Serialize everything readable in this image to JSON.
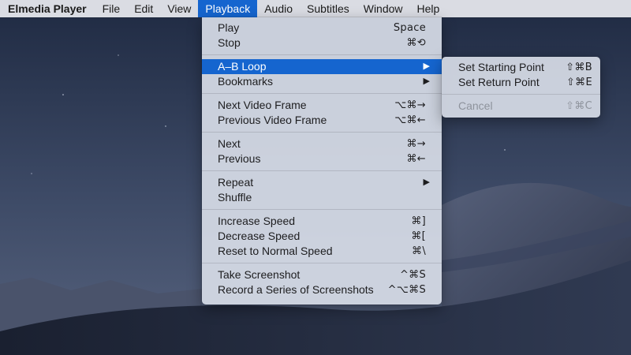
{
  "menubar": {
    "app": "Elmedia Player",
    "items": [
      {
        "label": "File"
      },
      {
        "label": "Edit"
      },
      {
        "label": "View"
      },
      {
        "label": "Playback"
      },
      {
        "label": "Audio"
      },
      {
        "label": "Subtitles"
      },
      {
        "label": "Window"
      },
      {
        "label": "Help"
      }
    ]
  },
  "playback_menu": {
    "play": {
      "label": "Play",
      "shortcut": "Space"
    },
    "stop": {
      "label": "Stop",
      "shortcut": "⌘⟲"
    },
    "ab_loop": {
      "label": "A–B Loop",
      "arrow": "▶"
    },
    "bookmarks": {
      "label": "Bookmarks",
      "arrow": "▶"
    },
    "next_frame": {
      "label": "Next Video Frame",
      "shortcut": "⌥⌘→"
    },
    "prev_frame": {
      "label": "Previous Video Frame",
      "shortcut": "⌥⌘←"
    },
    "next": {
      "label": "Next",
      "shortcut": "⌘→"
    },
    "previous": {
      "label": "Previous",
      "shortcut": "⌘←"
    },
    "repeat": {
      "label": "Repeat",
      "arrow": "▶"
    },
    "shuffle": {
      "label": "Shuffle"
    },
    "increase_speed": {
      "label": "Increase Speed",
      "shortcut": "⌘]"
    },
    "decrease_speed": {
      "label": "Decrease Speed",
      "shortcut": "⌘["
    },
    "reset_speed": {
      "label": "Reset to Normal Speed",
      "shortcut": "⌘\\"
    },
    "take_screenshot": {
      "label": "Take Screenshot",
      "shortcut": "^⌘S"
    },
    "record_screenshots": {
      "label": "Record a Series of Screenshots",
      "shortcut": "^⌥⌘S"
    }
  },
  "ab_submenu": {
    "set_start": {
      "label": "Set Starting Point",
      "shortcut": "⇧⌘B"
    },
    "set_return": {
      "label": "Set Return Point",
      "shortcut": "⇧⌘E"
    },
    "cancel": {
      "label": "Cancel",
      "shortcut": "⇧⌘C"
    }
  },
  "colors": {
    "highlight": "#1565cf",
    "menubar": "#eaecf1",
    "menu": "#d6dbe6",
    "disabled_text": "#8e939c"
  }
}
